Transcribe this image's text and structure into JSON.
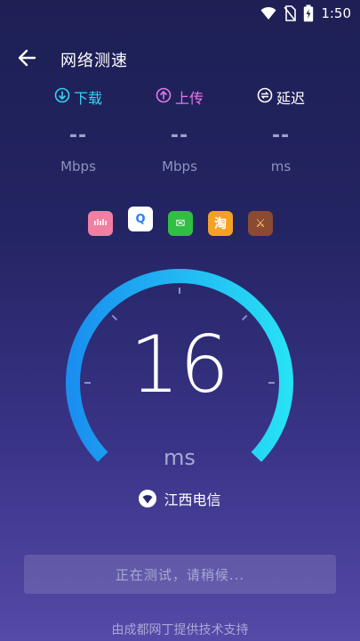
{
  "status_bar": {
    "time": "1:50",
    "icons": [
      "wifi-icon",
      "no-sim-icon",
      "battery-charging-icon"
    ]
  },
  "header": {
    "title": "网络测速",
    "back_icon": "back-arrow-icon"
  },
  "metrics": [
    {
      "label": "下载",
      "value": "--",
      "unit": "Mbps",
      "icon": "download-icon",
      "color": "#35d2f0"
    },
    {
      "label": "上传",
      "value": "--",
      "unit": "Mbps",
      "icon": "upload-icon",
      "color": "#e07ae6"
    },
    {
      "label": "延迟",
      "value": "--",
      "unit": "ms",
      "icon": "latency-icon",
      "color": "#ffffff"
    }
  ],
  "app_icons": [
    {
      "name": "bilibili-icon",
      "glyph": "ılılı",
      "bg": "#f27ea2",
      "fg": "#ffffff"
    },
    {
      "name": "qq-icon",
      "glyph": "Q",
      "bg": "#ffffff",
      "fg": "#2b7cff"
    },
    {
      "name": "wechat-icon",
      "glyph": "✉",
      "bg": "#2fbf42",
      "fg": "#ffffff"
    },
    {
      "name": "taobao-icon",
      "glyph": "淘",
      "bg": "#f5a125",
      "fg": "#ffffff"
    },
    {
      "name": "game-icon",
      "glyph": "⚔",
      "bg": "#8b4a32",
      "fg": "#ffd36b"
    }
  ],
  "gauge": {
    "value": "16",
    "unit": "ms",
    "accent_start": "#1a8ff0",
    "accent_end": "#27e1f5"
  },
  "isp": {
    "name": "江西电信",
    "icon": "wifi-circle-icon"
  },
  "action": {
    "label": "正在测试，请稍候..."
  },
  "footer": {
    "text": "由成都网丁提供技术支持"
  }
}
